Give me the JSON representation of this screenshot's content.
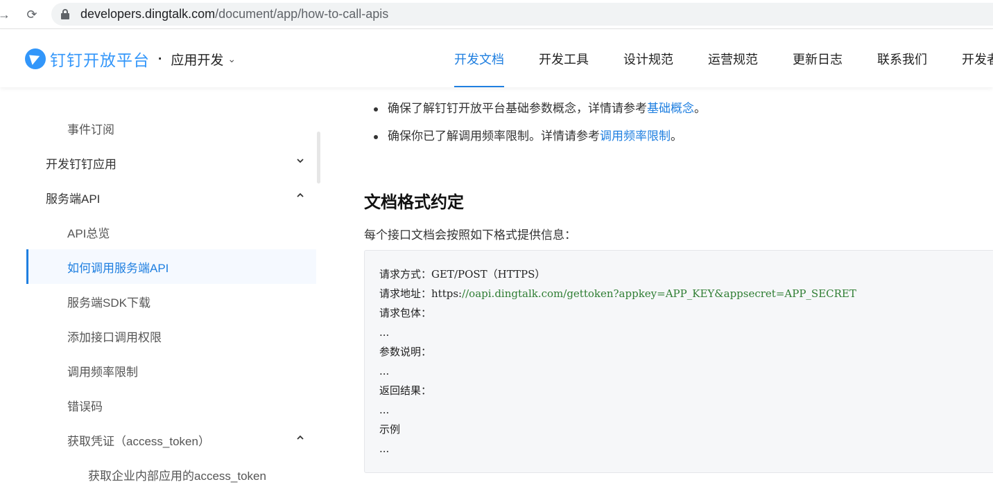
{
  "browser": {
    "url_host": "developers.dingtalk.com",
    "url_path": "/document/app/how-to-call-apis",
    "back_icon": "→",
    "reload_icon": "⟳"
  },
  "header": {
    "logo_text": "钉钉开放平台",
    "app_switch_dot": "·",
    "app_switch_label": "应用开发",
    "app_switch_chevron": "⌄",
    "nav": [
      "开发文档",
      "开发工具",
      "设计规范",
      "运营规范",
      "更新日志",
      "联系我们",
      "开发者"
    ],
    "active_nav": 0,
    "accent": "#1f7fe0"
  },
  "sidebar": {
    "items": [
      {
        "label": "事件订阅",
        "level": 2
      },
      {
        "label": "开发钉钉应用",
        "level": 1,
        "arrow": "down"
      },
      {
        "label": "服务端API",
        "level": 1,
        "arrow": "up"
      },
      {
        "label": "API总览",
        "level": 2
      },
      {
        "label": "如何调用服务端API",
        "level": 2,
        "active": true
      },
      {
        "label": "服务端SDK下载",
        "level": 2
      },
      {
        "label": "添加接口调用权限",
        "level": 2
      },
      {
        "label": "调用频率限制",
        "level": 2
      },
      {
        "label": "错误码",
        "level": 2
      },
      {
        "label": "获取凭证（access_token）",
        "level": 2,
        "arrow": "up"
      },
      {
        "label": "获取企业内部应用的access_token",
        "level": 3
      }
    ]
  },
  "content": {
    "bullets": [
      {
        "text": "确保了解钉钉开放平台基础参数概念，详情请参考",
        "link": "基础概念",
        "tail": "。"
      },
      {
        "text": "确保你已了解调用频率限制。详情请参考",
        "link": "调用频率限制",
        "tail": "。"
      }
    ],
    "heading": "文档格式约定",
    "lead": "每个接口文档会按照如下格式提供信息：",
    "code": {
      "line1": "请求方式：GET/POST（HTTPS）",
      "line2_prefix": "请求地址：https:",
      "line2_link": "//oapi.dingtalk.com/gettoken?appkey=APP_KEY&appsecret=APP_SECRET",
      "line3": "请求包体：",
      "line4": "...",
      "line5": "参数说明：",
      "line6": "...",
      "line7": "返回结果：",
      "line8": "...",
      "line9": "示例",
      "line10": "..."
    }
  }
}
